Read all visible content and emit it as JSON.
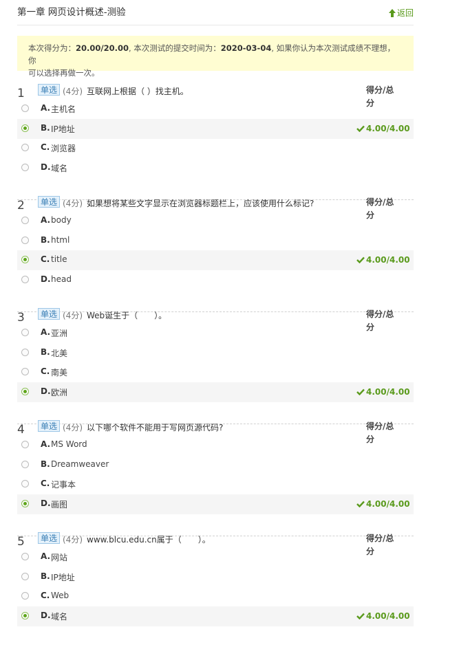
{
  "page": {
    "title": "第一章 网页设计概述-测验",
    "back_label": "返回"
  },
  "notice": {
    "score_prefix": "本次得分为：",
    "score": "20.00/20.00",
    "time_prefix": ", 本次测试的提交时间为：",
    "time": "2020-03-04",
    "suffix_line1": ", 如果你认为本次测试成绩不理想，你",
    "line2": "可以选择再做一次。"
  },
  "score_label": "得分/总分",
  "colors": {
    "accent_green": "#5a9a1c",
    "notice_bg": "#fffdd2",
    "type_badge": "#e4f1fb"
  },
  "questions": [
    {
      "number": "1",
      "type": "单选",
      "points": "(4分)",
      "text": "互联网上根据（ ）找主机。",
      "score_label_line1": "得分/总",
      "score_label_line2": "分",
      "options": [
        {
          "letter": "A.",
          "text": "主机名"
        },
        {
          "letter": "B.",
          "text": "IP地址"
        },
        {
          "letter": "C.",
          "text": "浏览器"
        },
        {
          "letter": "D.",
          "text": "域名"
        }
      ],
      "selected": 1,
      "score": "4.00/4.00"
    },
    {
      "number": "2",
      "type": "单选",
      "points": "(4分)",
      "text": "如果想将某些文字显示在浏览器标题栏上，应该使用什么标记?",
      "score_label_line1": "得分/总",
      "score_label_line2": "分",
      "options": [
        {
          "letter": "A.",
          "text": "body"
        },
        {
          "letter": "B.",
          "text": "html"
        },
        {
          "letter": "C.",
          "text": "title"
        },
        {
          "letter": "D.",
          "text": "head"
        }
      ],
      "selected": 2,
      "score": "4.00/4.00"
    },
    {
      "number": "3",
      "type": "单选",
      "points": "(4分)",
      "text": "Web诞生于（　　）。",
      "score_label_line1": "得分/总",
      "score_label_line2": "分",
      "options": [
        {
          "letter": "A.",
          "text": "亚洲"
        },
        {
          "letter": "B.",
          "text": "北美"
        },
        {
          "letter": "C.",
          "text": "南美"
        },
        {
          "letter": "D.",
          "text": "欧洲"
        }
      ],
      "selected": 3,
      "score": "4.00/4.00"
    },
    {
      "number": "4",
      "type": "单选",
      "points": "(4分)",
      "text": "以下哪个软件不能用于写网页源代码?",
      "score_label_line1": "得分/总",
      "score_label_line2": "分",
      "options": [
        {
          "letter": "A.",
          "text": "MS Word"
        },
        {
          "letter": "B.",
          "text": "Dreamweaver"
        },
        {
          "letter": "C.",
          "text": "记事本"
        },
        {
          "letter": "D.",
          "text": "画图"
        }
      ],
      "selected": 3,
      "score": "4.00/4.00"
    },
    {
      "number": "5",
      "type": "单选",
      "points": "(4分)",
      "text": "www.blcu.edu.cn属于（　　）。",
      "score_label_line1": "得分/总",
      "score_label_line2": "分",
      "options": [
        {
          "letter": "A.",
          "text": "网站"
        },
        {
          "letter": "B.",
          "text": "IP地址"
        },
        {
          "letter": "C.",
          "text": "Web"
        },
        {
          "letter": "D.",
          "text": "域名"
        }
      ],
      "selected": 3,
      "score": "4.00/4.00"
    }
  ]
}
